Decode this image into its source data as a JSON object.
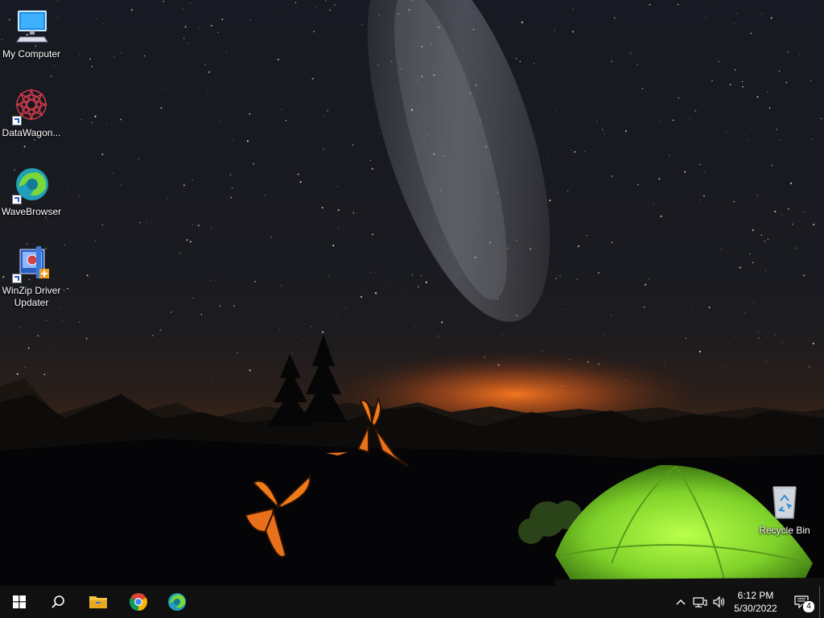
{
  "desktop": {
    "icons": [
      {
        "label": "My Computer",
        "icon": "monitor-icon"
      },
      {
        "label": "DataWagon...",
        "icon": "mandala-icon"
      },
      {
        "label": "WaveBrowser",
        "icon": "wave-icon"
      },
      {
        "label": "WinZip Driver Updater",
        "icon": "winzip-icon"
      }
    ],
    "recycle_bin": {
      "label": "Recycle Bin",
      "icon": "recycle-bin-icon"
    }
  },
  "taskbar": {
    "pinned": [
      {
        "name": "start",
        "icon": "windows-logo-icon"
      },
      {
        "name": "search",
        "icon": "search-icon"
      },
      {
        "name": "file-explorer",
        "icon": "folder-icon"
      },
      {
        "name": "chrome",
        "icon": "chrome-icon"
      },
      {
        "name": "edge",
        "icon": "edge-icon"
      }
    ],
    "tray": {
      "time": "6:12 PM",
      "date": "5/30/2022",
      "notification_count": "4"
    }
  },
  "colors": {
    "taskbar": "#101010",
    "tent": "#8fe032",
    "horizon": "#e06a1a",
    "butterfly": "#f07a18"
  }
}
